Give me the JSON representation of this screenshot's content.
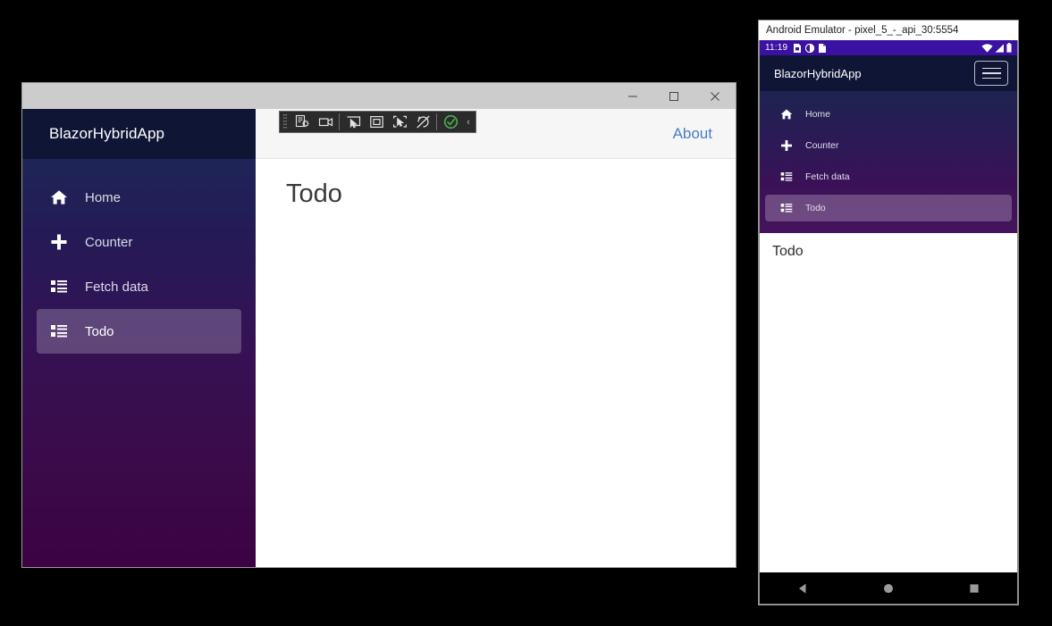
{
  "desktop": {
    "window_controls": [
      {
        "name": "minimize",
        "glyph": "minimize-icon"
      },
      {
        "name": "maximize",
        "glyph": "maximize-icon"
      },
      {
        "name": "close",
        "glyph": "close-icon"
      }
    ],
    "sidebar": {
      "brand": "BlazorHybridApp",
      "items": [
        {
          "label": "Home",
          "icon": "home-icon",
          "active": false
        },
        {
          "label": "Counter",
          "icon": "plus-icon",
          "active": false
        },
        {
          "label": "Fetch data",
          "icon": "list-icon",
          "active": false
        },
        {
          "label": "Todo",
          "icon": "list-icon",
          "active": true
        }
      ]
    },
    "topbar": {
      "about_label": "About"
    },
    "content": {
      "page_title": "Todo"
    },
    "vs_toolbar": {
      "tools": [
        {
          "name": "go-to-live-visual-tree-icon"
        },
        {
          "name": "live-preview-camera-icon"
        },
        {
          "name": "select-element-icon"
        },
        {
          "name": "display-layout-adorner-icon"
        },
        {
          "name": "track-focused-element-icon"
        },
        {
          "name": "disable-hot-reload-icon"
        },
        {
          "name": "hot-reload-enabled-icon"
        }
      ],
      "collapse_glyph": "‹"
    },
    "footer_hint_left": "",
    "footer_hint_right": ""
  },
  "emulator": {
    "window_title": "Android Emulator - pixel_5_-_api_30:5554",
    "status_bar": {
      "clock": "11:19",
      "left_icons": [
        "sim-card-icon",
        "contrast-icon",
        "sd-card-icon"
      ],
      "right_icons": [
        "wifi-icon",
        "signal-icon",
        "battery-icon"
      ]
    },
    "app_bar": {
      "title": "BlazorHybridApp",
      "menu_button": "hamburger-menu-icon"
    },
    "nav": {
      "items": [
        {
          "label": "Home",
          "icon": "home-icon",
          "active": false
        },
        {
          "label": "Counter",
          "icon": "plus-icon",
          "active": false
        },
        {
          "label": "Fetch data",
          "icon": "list-icon",
          "active": false
        },
        {
          "label": "Todo",
          "icon": "list-icon",
          "active": true
        }
      ]
    },
    "content": {
      "page_title": "Todo"
    },
    "system_nav": [
      {
        "name": "back-button",
        "icon": "triangle-left-icon"
      },
      {
        "name": "home-button",
        "icon": "circle-icon"
      },
      {
        "name": "recents-button",
        "icon": "square-icon"
      }
    ]
  },
  "colors": {
    "accent_purple": "#3a11a0",
    "brand_navy": "#0f1535",
    "link_blue": "#4a7ec4",
    "hot_reload_green": "#4caf50"
  }
}
